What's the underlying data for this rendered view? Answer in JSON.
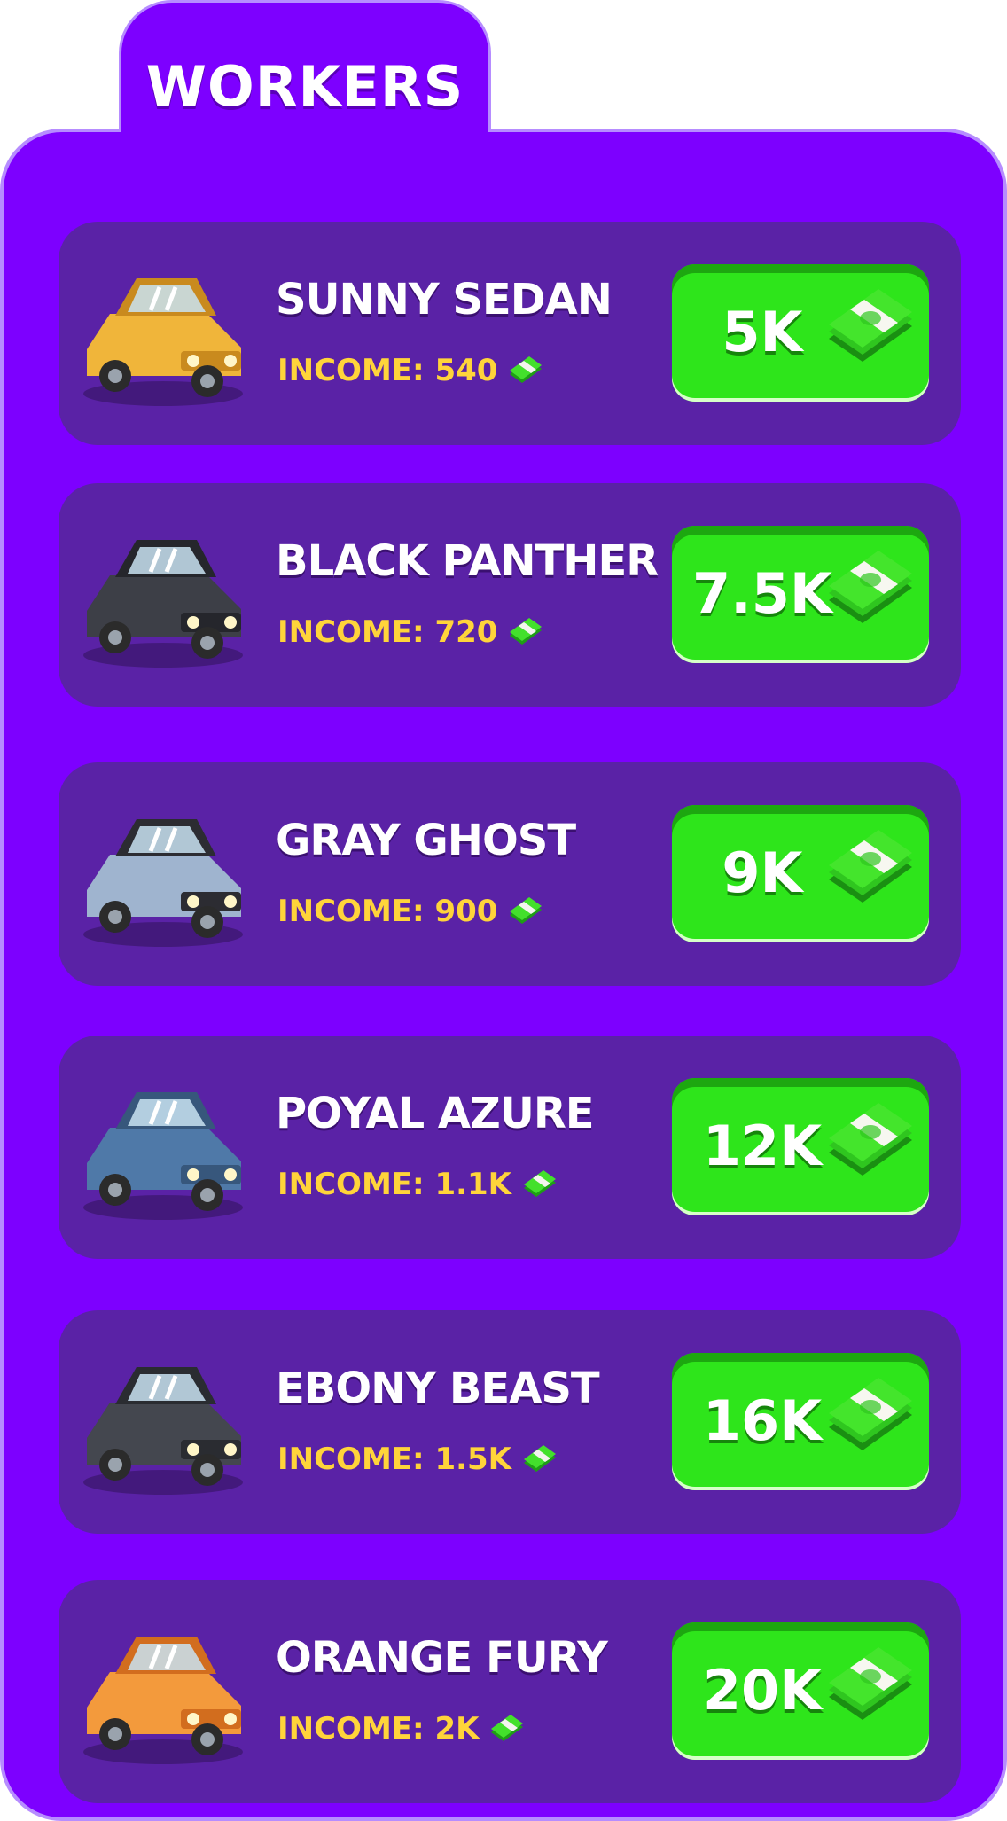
{
  "title": "WORKERS",
  "workers": [
    {
      "name": "SUNNY SEDAN",
      "income": "INCOME: 540",
      "price": "5K",
      "car_color": "#f0b53a",
      "car_shade": "#c98a1e",
      "car_type": "sedan"
    },
    {
      "name": "BLACK PANTHER",
      "income": "INCOME: 720",
      "price": "7.5K",
      "car_color": "#3d3f47",
      "car_shade": "#25262c",
      "car_type": "sedan"
    },
    {
      "name": "GRAY GHOST",
      "income": "INCOME: 900",
      "price": "9K",
      "car_color": "#9fb4cf",
      "car_shade": "#2c2c32",
      "car_type": "sport"
    },
    {
      "name": "POYAL AZURE",
      "income": "INCOME: 1.1K",
      "price": "12K",
      "car_color": "#4f79a8",
      "car_shade": "#37577c",
      "car_type": "classic"
    },
    {
      "name": "EBONY BEAST",
      "income": "INCOME: 1.5K",
      "price": "16K",
      "car_color": "#44474f",
      "car_shade": "#2a2c31",
      "car_type": "suv"
    },
    {
      "name": "ORANGE FURY",
      "income": "INCOME: 2K",
      "price": "20K",
      "car_color": "#f39a3c",
      "car_shade": "#d26d1e",
      "car_type": "sport"
    }
  ],
  "colors": {
    "panel": "#7d00ff",
    "card": "#5a22a6",
    "button": "#2ee51b",
    "income_text": "#ffd43a"
  },
  "icons": {
    "currency": "cash-stack-icon"
  }
}
